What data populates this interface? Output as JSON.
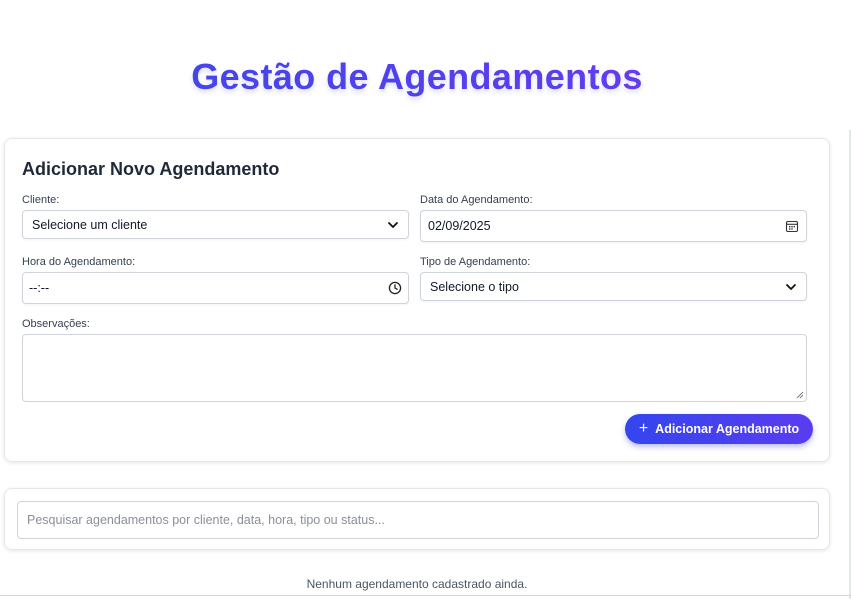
{
  "page": {
    "title": "Gestão de Agendamentos"
  },
  "form": {
    "title": "Adicionar Novo Agendamento",
    "cliente": {
      "label": "Cliente:",
      "value": "Selecione um cliente"
    },
    "data": {
      "label": "Data do Agendamento:",
      "value": "02/09/2025"
    },
    "hora": {
      "label": "Hora do Agendamento:",
      "value": "--:--"
    },
    "tipo": {
      "label": "Tipo de Agendamento:",
      "value": "Selecione o tipo"
    },
    "observacoes": {
      "label": "Observações:",
      "value": ""
    },
    "submit_label": "Adicionar Agendamento"
  },
  "search": {
    "placeholder": "Pesquisar agendamentos por cliente, data, hora, tipo ou status...",
    "value": ""
  },
  "list": {
    "empty_message": "Nenhum agendamento cadastrado ainda."
  },
  "colors": {
    "accent_start": "#3446ee",
    "accent_end": "#7c3aed",
    "text": "#1f2937",
    "border": "#cfd4da"
  },
  "icons": {
    "select_arrow": "chevron-down-icon",
    "date": "calendar-icon",
    "time": "clock-icon",
    "add": "plus-icon"
  }
}
